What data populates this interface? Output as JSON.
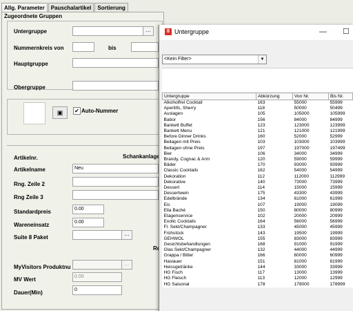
{
  "tabs": [
    {
      "label": "Allg. Parameter",
      "active": true
    },
    {
      "label": "Pauschalartikel",
      "active": false
    },
    {
      "label": "Sortierung",
      "active": false
    }
  ],
  "groups": {
    "title": "Zugeordnete Gruppen",
    "untergruppe": "Untergruppe",
    "nummernkreis": "Nummernkreis von",
    "bis": "bis",
    "hauptgruppe": "Hauptgruppe",
    "obergruppe": "Obergruppe",
    "dots": "…"
  },
  "auto": {
    "label": "Auto-Nummer",
    "checked": true,
    "checkmark": "✔"
  },
  "article": {
    "artikelnr": "Artikelnr.",
    "schankanlage": "Schankanlage",
    "artikelname": "Artikelname",
    "artikelname_value": "Neu",
    "rng2": "Rng. Zeile 2",
    "rng3": "Rng Zeile 3",
    "standardpreis": "Standardpreis",
    "standardpreis_value": "0.00",
    "wareneinsatz": "Wareneinsatz",
    "wareneinsatz_value": "0.00",
    "suite": "Suite 8 Paket",
    "re_label": "Re",
    "myvisitors": "MyVisitors Produktnu",
    "mvwert": "MV Wert",
    "mvwert_value": "0.00",
    "dauer": "Dauer(Min)",
    "dauer_value": "0"
  },
  "popup": {
    "app_icon": "8",
    "title": "Untergruppe",
    "minimize": "—",
    "maximize": "☐",
    "filter": "<Kein Filter>",
    "dropdown": "▼",
    "columns": [
      "Untergruppe",
      "Abkürzung",
      "Von Nr.",
      "Bis Nr."
    ],
    "rows": [
      [
        "Alkoholfrei Cocktail",
        "163",
        "55000",
        "55999"
      ],
      [
        "Aperitifs, Sherry",
        "118",
        "50000",
        "50499"
      ],
      [
        "Auslagen",
        "105",
        "105000",
        "105999"
      ],
      [
        "Babor",
        "156",
        "84000",
        "84999"
      ],
      [
        "Bankett Buffet",
        "123",
        "123000",
        "123999"
      ],
      [
        "Bankett Menu",
        "121",
        "121000",
        "121999"
      ],
      [
        "Before Dinner Drinks",
        "160",
        "52000",
        "52999"
      ],
      [
        "Beilagen mit Preis",
        "103",
        "103000",
        "103999"
      ],
      [
        "Beilagen ohne Preis",
        "197",
        "197000",
        "197499"
      ],
      [
        "Bier",
        "106",
        "34000",
        "34999"
      ],
      [
        "Brandy, Cognac & Arm",
        "120",
        "59000",
        "59999"
      ],
      [
        "Bäder",
        "170",
        "93000",
        "93999"
      ],
      [
        "Classic Cocktails",
        "162",
        "54000",
        "54999"
      ],
      [
        "Dekoration",
        "112",
        "112000",
        "112999"
      ],
      [
        "Dekorative",
        "140",
        "73000",
        "73999"
      ],
      [
        "Dessert",
        "114",
        "15000",
        "15999"
      ],
      [
        "Dessertwein",
        "175",
        "43300",
        "43999"
      ],
      [
        "Edelbrände",
        "134",
        "61000",
        "61999"
      ],
      [
        "Eis",
        "107",
        "19000",
        "19099"
      ],
      [
        "Ella Baché",
        "150",
        "80000",
        "80999"
      ],
      [
        "Etagenservice",
        "102",
        "20000",
        "20999"
      ],
      [
        "Exotic Cocktails",
        "164",
        "56000",
        "56999"
      ],
      [
        "Fl. Sekt/Champagner",
        "133",
        "45000",
        "45999"
      ],
      [
        "Frühstück",
        "143",
        "19500",
        "19999"
      ],
      [
        "GEHWOL",
        "155",
        "83000",
        "83999"
      ],
      [
        "Gesichtsbehandlungen",
        "168",
        "91000",
        "91999"
      ],
      [
        "Glas Sekt/Champagner",
        "132",
        "44000",
        "44999"
      ],
      [
        "Grappa / Bitter",
        "166",
        "60000",
        "60999"
      ],
      [
        "Haslauer",
        "151",
        "81000",
        "81999"
      ],
      [
        "Heissgetränke",
        "144",
        "33000",
        "33999"
      ],
      [
        "HG Fisch",
        "117",
        "13000",
        "13999"
      ],
      [
        "HG Fleisch",
        "113",
        "12000",
        "12999"
      ],
      [
        "HG Saisonal",
        "178",
        "178000",
        "178999"
      ]
    ]
  }
}
